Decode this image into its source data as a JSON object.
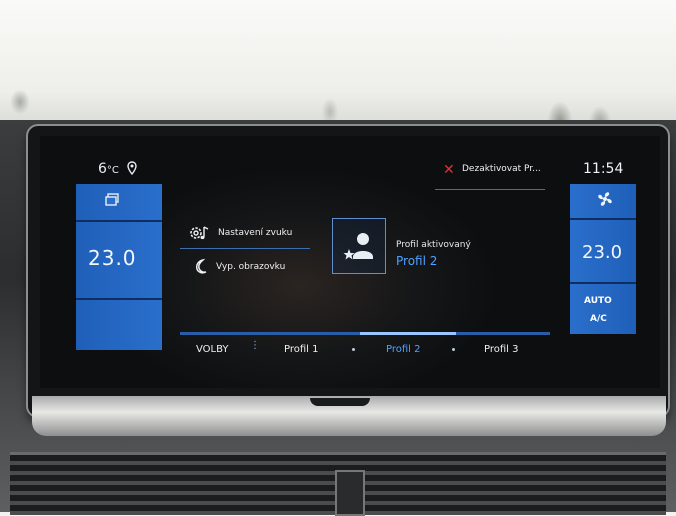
{
  "status_bar": {
    "outside_temp": "6",
    "outside_temp_unit": "°C",
    "location_icon": "location-pin-icon",
    "deactivate_label": "Dezaktivovat Pr...",
    "deactivate_icon": "close-icon",
    "clock": "11:54"
  },
  "climate_left": {
    "mode_icon": "copy-windows-icon",
    "temperature": "23.0"
  },
  "climate_right": {
    "fan_icon": "fan-icon",
    "temperature": "23.0",
    "auto_label": "AUTO",
    "ac_label": "A/C"
  },
  "menu": {
    "items": [
      {
        "label": "Nastavení zvuku",
        "icon": "sound-settings-icon"
      },
      {
        "label": "Vyp. obrazovku",
        "icon": "moon-icon"
      }
    ]
  },
  "profile": {
    "icon": "profile-star-icon",
    "status": "Profil aktivovaný",
    "name": "Profil 2"
  },
  "tabs": {
    "options_label": "VOLBY",
    "items": [
      {
        "label": "Profil 1"
      },
      {
        "label": "Profil 2",
        "active": true
      },
      {
        "label": "Profil 3"
      }
    ]
  },
  "colors": {
    "accent_blue": "#4fa0ff",
    "strip_blue": "#2a6fcc",
    "alert_red": "#e2303a"
  }
}
